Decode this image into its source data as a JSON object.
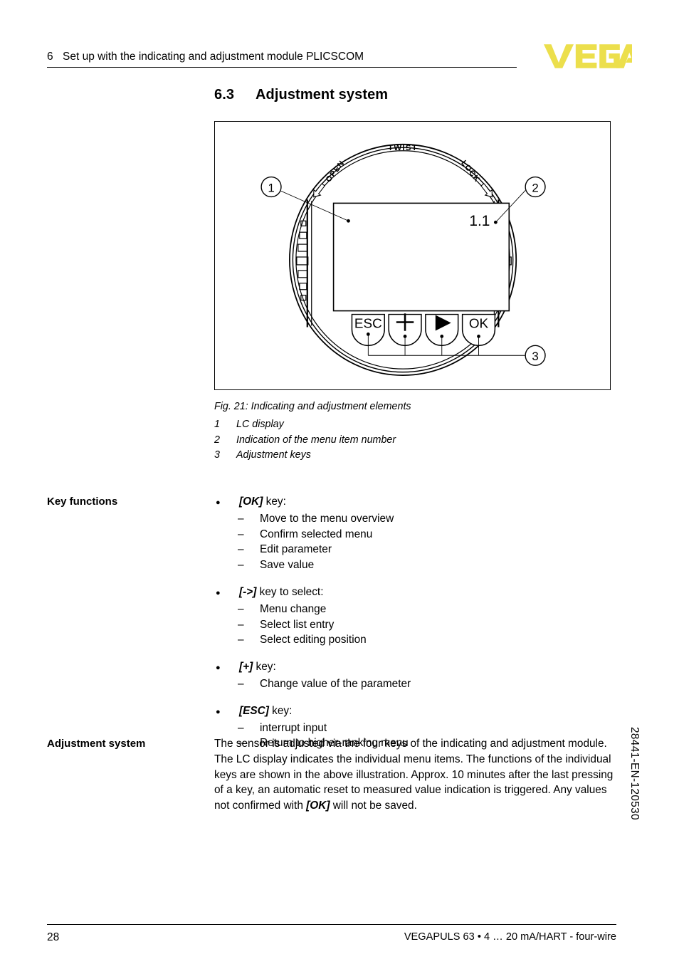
{
  "header": {
    "chapter_number": "6",
    "chapter_title": "Set up with the indicating and adjustment module PLICSCOM",
    "logo_text": "VEGA",
    "logo_color": "#ecdf4c"
  },
  "section": {
    "number": "6.3",
    "title": "Adjustment system"
  },
  "figure": {
    "caption": "Fig. 21: Indicating and adjustment elements",
    "legend": [
      {
        "index": "1",
        "text": "LC display"
      },
      {
        "index": "2",
        "text": "Indication of the menu item number"
      },
      {
        "index": "3",
        "text": "Adjustment keys"
      }
    ],
    "diagram": {
      "twist_label": "TWIST",
      "open_label": "OPEN",
      "lock_label": "LOCK",
      "display_value": "1.1",
      "callouts": [
        "1",
        "2",
        "3"
      ],
      "keys": [
        "ESC",
        "+",
        "▷",
        "OK"
      ]
    }
  },
  "key_functions": {
    "label": "Key functions",
    "groups": [
      {
        "key": "[OK]",
        "suffix": " key:",
        "items": [
          "Move to the menu overview",
          "Confirm selected menu",
          "Edit parameter",
          "Save value"
        ]
      },
      {
        "key": "[->]",
        "suffix": " key to select:",
        "items": [
          "Menu change",
          "Select list entry",
          "Select editing position"
        ]
      },
      {
        "key": "[+]",
        "suffix": " key:",
        "items": [
          "Change value of the parameter"
        ]
      },
      {
        "key": "[ESC]",
        "suffix": " key:",
        "items": [
          "interrupt input",
          "Return to higher-ranking menu"
        ]
      }
    ]
  },
  "adjustment_system": {
    "label": "Adjustment system",
    "paragraph_part1": "The sensor is adjusted via the four keys of the indicating and adjustment module. The LC display indicates the individual menu items. The functions of the individual keys are shown in the above illustration. Approx. 10 minutes after the last pressing of a key, an automatic reset to measured value indication is triggered. Any values not confirmed with ",
    "paragraph_emphasis": "[OK]",
    "paragraph_part2": " will not be saved."
  },
  "footer": {
    "page_number": "28",
    "product_line": "VEGAPULS 63 • 4 … 20 mA/HART - four-wire",
    "document_number": "28441-EN-120530"
  }
}
